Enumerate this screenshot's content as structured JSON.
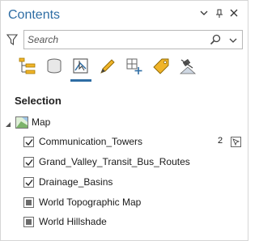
{
  "pane": {
    "title": "Contents",
    "controls": [
      "chevron-down-icon",
      "pin-icon",
      "close-icon"
    ]
  },
  "search": {
    "placeholder": "Search",
    "value": ""
  },
  "toolbar": {
    "tools": [
      "list-by-drawing-order-icon",
      "list-by-data-source-icon",
      "list-by-selection-icon",
      "list-by-editing-icon",
      "list-by-snapping-icon",
      "list-by-labeling-icon",
      "list-by-perspective-imagery-icon"
    ],
    "active_tool": "list-by-selection-icon"
  },
  "section": {
    "label": "Selection"
  },
  "map": {
    "label": "Map",
    "layers": [
      {
        "name": "Communication_Towers",
        "state": "checked",
        "selection_count": "2"
      },
      {
        "name": "Grand_Valley_Transit_Bus_Routes",
        "state": "checked"
      },
      {
        "name": "Drainage_Basins",
        "state": "checked"
      },
      {
        "name": "World Topographic Map",
        "state": "partial"
      },
      {
        "name": "World Hillshade",
        "state": "partial"
      }
    ]
  },
  "colors": {
    "accent": "#2e6da4",
    "title_text": "#2e6da4",
    "border": "#d6d6d6"
  }
}
